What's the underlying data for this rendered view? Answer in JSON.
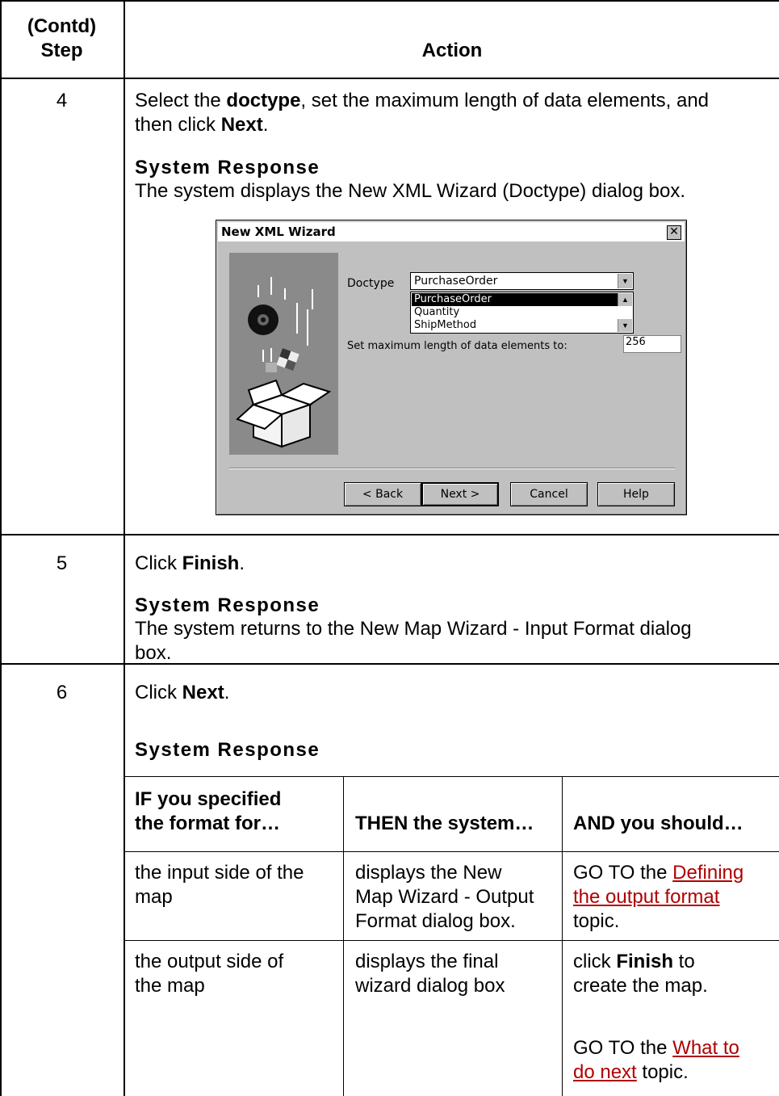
{
  "header": {
    "step_line1": "(Contd)",
    "step_line2": "Step",
    "action": "Action"
  },
  "rows": [
    {
      "step": "4",
      "instruction_pre": "Select the ",
      "instruction_b1": "doctype",
      "instruction_mid": ", set the maximum length of data elements, and",
      "instruction_line2_pre": "then click ",
      "instruction_b2": "Next",
      "instruction_end": ".",
      "response_heading": "System Response",
      "response_text": "The system displays the New XML Wizard (Doctype) dialog box."
    },
    {
      "step": "5",
      "instruction_pre": "Click ",
      "instruction_b1": "Finish",
      "instruction_end": ".",
      "response_heading": "System Response",
      "response_line1": "The system returns to the New Map Wizard - Input Format dialog",
      "response_line2": "box."
    },
    {
      "step": "6",
      "instruction_pre": "Click ",
      "instruction_b1": "Next",
      "instruction_end": ".",
      "response_heading": "System Response"
    }
  ],
  "dialog": {
    "title": "New XML Wizard",
    "close_glyph": "✕",
    "doctype_label": "Doctype",
    "doctype_value": "PurchaseOrder",
    "list_items": [
      "PurchaseOrder",
      "Quantity",
      "ShipMethod"
    ],
    "max_label": "Set maximum length of data elements to:",
    "max_value": "256",
    "buttons": {
      "back": "< Back",
      "next": "Next >",
      "cancel": "Cancel",
      "help": "Help"
    }
  },
  "inner_table": {
    "headers": [
      "IF you specified",
      "the format for…",
      "THEN the system…",
      "AND you should…"
    ],
    "row1": {
      "if": [
        "the input side of the",
        "map"
      ],
      "then": [
        "displays the New",
        "Map Wizard - Output",
        "Format dialog box."
      ],
      "and_pre": "GO TO the ",
      "and_link1": "Defining ",
      "and_link2": "the output format",
      "and_post": "topic."
    },
    "row2": {
      "if": [
        "the output side of",
        "the map"
      ],
      "then": [
        "displays the final",
        "wizard dialog box"
      ],
      "and1_pre": "click ",
      "and1_b": "Finish",
      "and1_post": " to",
      "and1_line2": "create the map.",
      "and2_pre": "GO TO the ",
      "and2_link1": "What to ",
      "and2_link2": "do next",
      "and2_post": " topic."
    }
  }
}
